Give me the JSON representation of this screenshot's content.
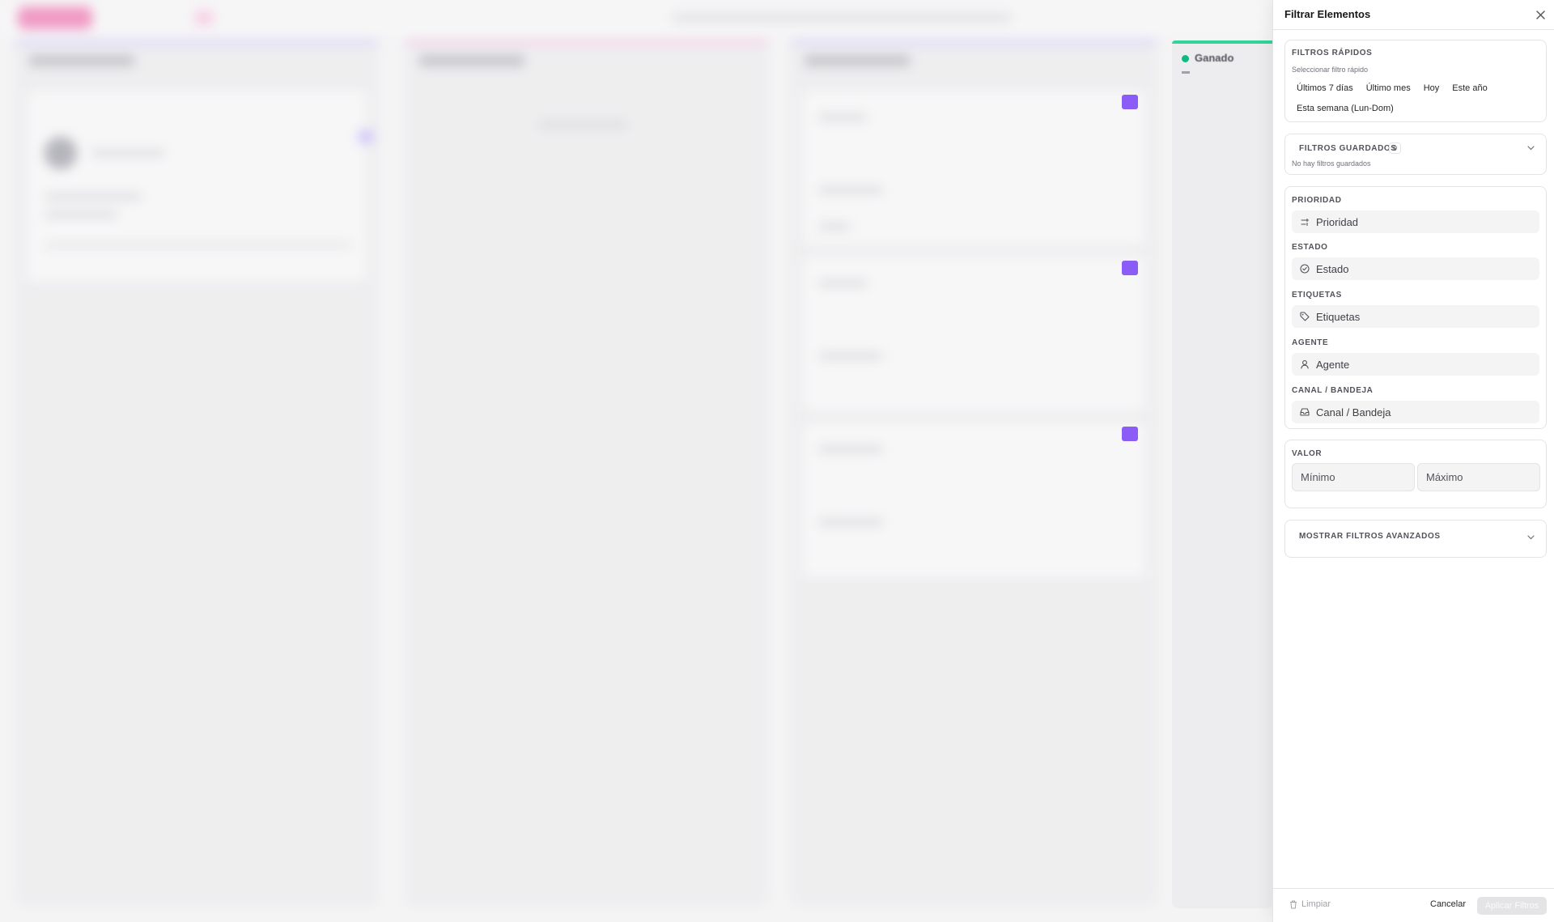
{
  "drawer": {
    "title": "Filtrar Elementos",
    "quick_filters": {
      "label": "Filtros rápidos",
      "hint": "Seleccionar filtro rápido",
      "options": [
        "Últimos 7 días",
        "Último mes",
        "Hoy",
        "Este año",
        "Esta semana (Lun-Dom)"
      ]
    },
    "saved_filters": {
      "label": "Filtros guardados",
      "count": "0",
      "empty_text": "No hay filtros guardados"
    },
    "fields": [
      {
        "label": "Prioridad",
        "button": "Prioridad",
        "icon": "priority-icon"
      },
      {
        "label": "Estado",
        "button": "Estado",
        "icon": "status-circle-icon"
      },
      {
        "label": "Etiquetas",
        "button": "Etiquetas",
        "icon": "tag-icon"
      },
      {
        "label": "Agente",
        "button": "Agente",
        "icon": "user-icon"
      },
      {
        "label": "Canal / Bandeja",
        "button": "Canal / Bandeja",
        "icon": "inbox-icon"
      }
    ],
    "value": {
      "label": "Valor",
      "min_placeholder": "Mínimo",
      "max_placeholder": "Máximo"
    },
    "advanced": {
      "label": "Mostrar filtros avanzados"
    },
    "footer": {
      "clear": "Limpiar",
      "cancel": "Cancelar",
      "apply": "Aplicar Filtros"
    }
  },
  "background": {
    "column_label": "Ganado"
  },
  "colors": {
    "accent_pink": "#ec4899",
    "accent_violet": "#8b5cf6",
    "accent_green": "#10b981"
  }
}
